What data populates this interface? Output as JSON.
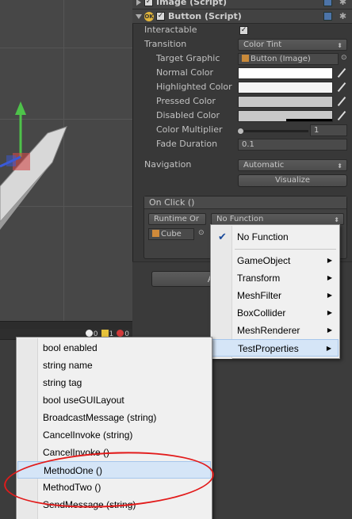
{
  "inspector": {
    "image_header": "Image (Script)",
    "button_header": "Button (Script)",
    "interactable_label": "Interactable",
    "interactable_checked": true,
    "transition_label": "Transition",
    "transition_value": "Color Tint",
    "target_graphic_label": "Target Graphic",
    "target_graphic_value": "Button (Image)",
    "normal_color_label": "Normal Color",
    "highlighted_color_label": "Highlighted Color",
    "pressed_color_label": "Pressed Color",
    "disabled_color_label": "Disabled Color",
    "color_multiplier_label": "Color Multiplier",
    "color_multiplier_value": "1",
    "fade_duration_label": "Fade Duration",
    "fade_duration_value": "0.1",
    "navigation_label": "Navigation",
    "navigation_value": "Automatic",
    "visualize_label": "Visualize",
    "onclick_title": "On Click ()",
    "runtime_value": "Runtime Or",
    "function_value": "No Function",
    "object_value": "Cube",
    "add_button_partial": "A",
    "colors": {
      "normal": "#ffffff",
      "highlighted": "#f5f5f5",
      "pressed": "#c8c8c8",
      "disabled": "#c8c8c8"
    }
  },
  "console": {
    "info_count": "0",
    "warn_count": "1",
    "error_count": "0"
  },
  "component_menu": {
    "items": [
      {
        "label": "No Function",
        "checked": true
      },
      {
        "label": "GameObject",
        "submenu": true
      },
      {
        "label": "Transform",
        "submenu": true
      },
      {
        "label": "MeshFilter",
        "submenu": true
      },
      {
        "label": "BoxCollider",
        "submenu": true
      },
      {
        "label": "MeshRenderer",
        "submenu": true
      },
      {
        "label": "TestProperties",
        "submenu": true,
        "highlighted": true
      }
    ]
  },
  "method_menu": {
    "items": [
      {
        "label": "bool enabled"
      },
      {
        "label": "string name"
      },
      {
        "label": "string tag"
      },
      {
        "label": "bool useGUILayout"
      },
      {
        "label": "BroadcastMessage (string)"
      },
      {
        "label": "CancelInvoke (string)"
      },
      {
        "label": "CancelInvoke ()"
      },
      {
        "label": "MethodOne ()",
        "highlighted": true
      },
      {
        "label": "MethodTwo ()"
      },
      {
        "label": "SendMessage (string)"
      }
    ]
  }
}
